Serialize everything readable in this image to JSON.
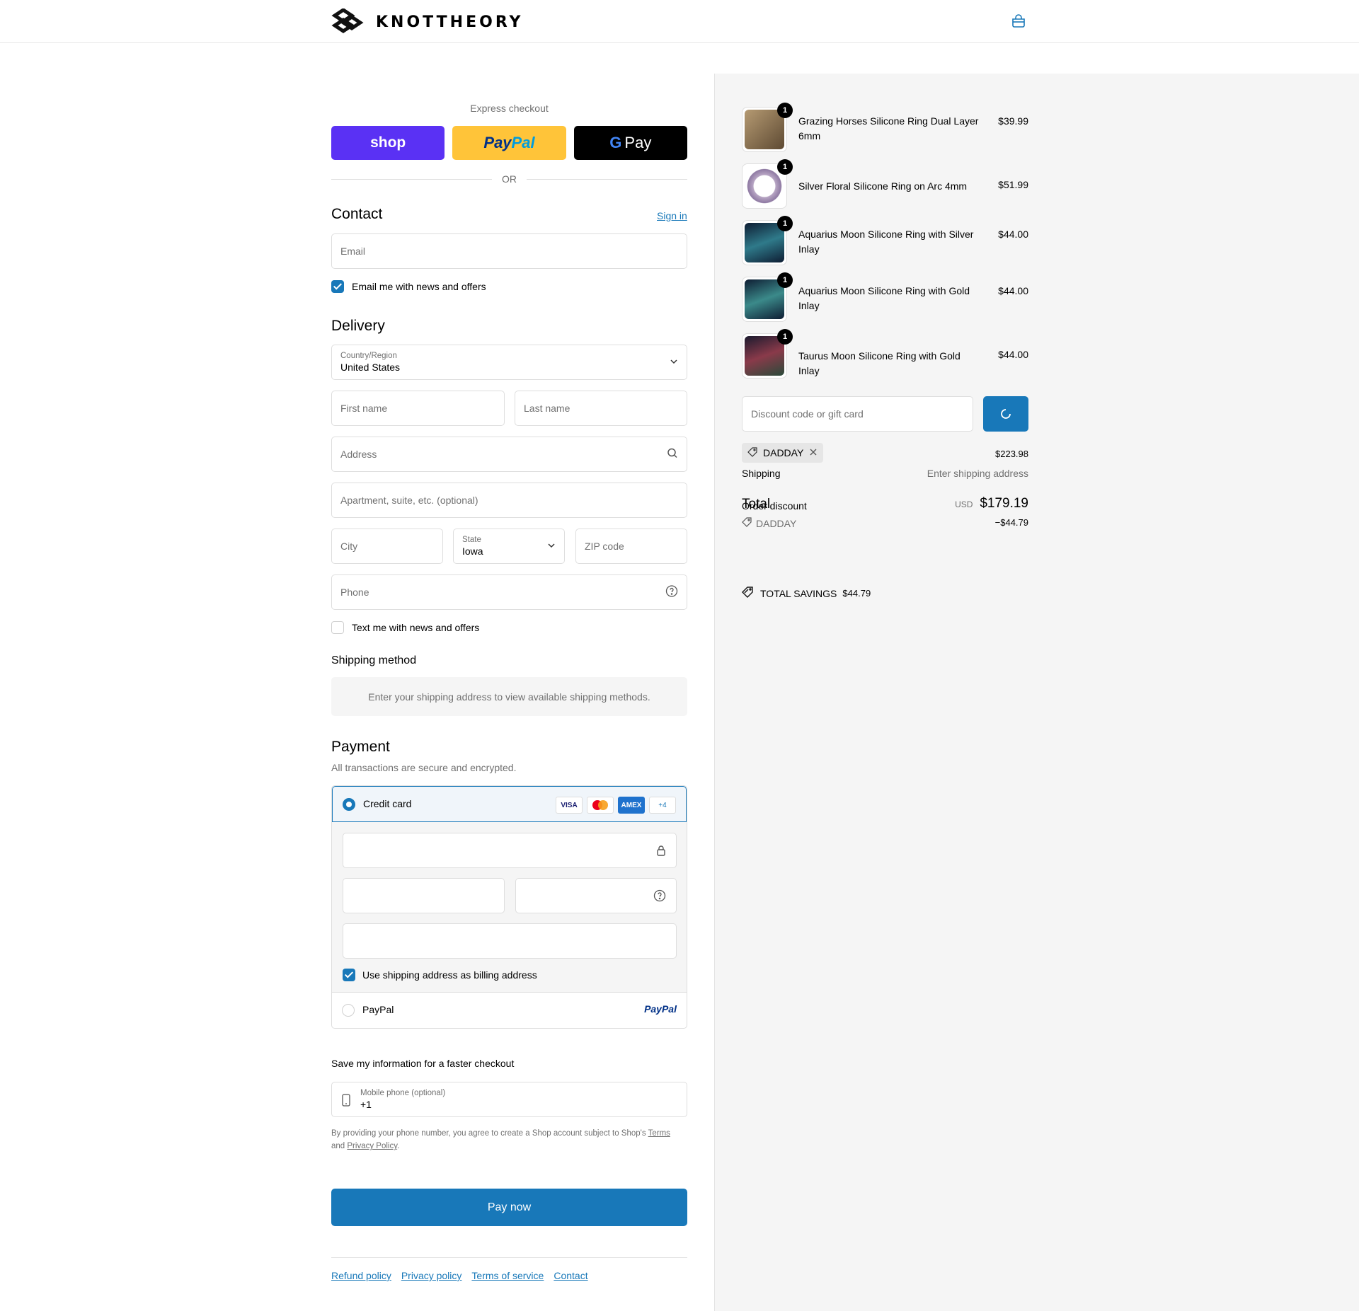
{
  "header": {
    "brand": "KNOTTHEORY"
  },
  "express": {
    "title": "Express checkout",
    "shop_label": "shop",
    "paypal_label_a": "Pay",
    "paypal_label_b": "Pal",
    "gpay_label": "Pay",
    "or_label": "OR"
  },
  "contact": {
    "title": "Contact",
    "sign_in": "Sign in",
    "email_placeholder": "Email",
    "news_label": "Email me with news and offers"
  },
  "delivery": {
    "title": "Delivery",
    "country_label": "Country/Region",
    "country_value": "United States",
    "first_name": "First name",
    "last_name": "Last name",
    "address": "Address",
    "apartment": "Apartment, suite, etc. (optional)",
    "city": "City",
    "state_label": "State",
    "state_value": "Iowa",
    "zip": "ZIP code",
    "phone": "Phone",
    "text_label": "Text me with news and offers"
  },
  "shipping_method": {
    "title": "Shipping method",
    "message": "Enter your shipping address to view available shipping methods."
  },
  "payment": {
    "title": "Payment",
    "subtitle": "All transactions are secure and encrypted.",
    "credit_card": "Credit card",
    "cards": [
      "VISA",
      "MC",
      "AMEX",
      "+4"
    ],
    "billing_label": "Use shipping address as billing address",
    "paypal": "PayPal",
    "paypal_logo": "PayPal"
  },
  "save_info": {
    "title": "Save my information for a faster checkout",
    "mobile_label": "Mobile phone (optional)",
    "mobile_value": "+1",
    "disclaimer_a": "By providing your phone number, you agree to create a Shop account subject to Shop's",
    "terms": "Terms",
    "and": "and",
    "privacy": "Privacy Policy",
    "period": "."
  },
  "pay_now": "Pay now",
  "footer": [
    "Refund policy",
    "Privacy policy",
    "Terms of service",
    "Contact"
  ],
  "summary": {
    "items": [
      {
        "name": "Grazing Horses Silicone Ring Dual Layer 6mm",
        "price": "$39.99",
        "qty": "1",
        "color": "#8a6e4a"
      },
      {
        "name": "Silver Floral Silicone Ring on Arc 4mm",
        "price": "$51.99",
        "qty": "1",
        "color": "#b8a6c4"
      },
      {
        "name": "Aquarius Moon Silicone Ring with Silver Inlay",
        "price": "$44.00",
        "qty": "1",
        "color": "#1f3b5c"
      },
      {
        "name": "Aquarius Moon Silicone Ring with Gold Inlay",
        "price": "$44.00",
        "qty": "1",
        "color": "#1c3a55"
      },
      {
        "name": "Taurus Moon Silicone Ring with Gold Inlay",
        "price": "$44.00",
        "qty": "1",
        "color": "#3a2a40"
      }
    ],
    "discount_placeholder": "Discount code or gift card",
    "code": "DADDAY",
    "subtotal_value": "$223.98",
    "shipping_label": "Shipping",
    "shipping_value": "Enter shipping address",
    "total_label": "Total",
    "order_discount_label": "Order discount",
    "currency": "USD",
    "total_value": "$179.19",
    "discount_code": "DADDAY",
    "discount_value": "−$44.79",
    "savings_label": "TOTAL SAVINGS",
    "savings_value": "$44.79"
  }
}
